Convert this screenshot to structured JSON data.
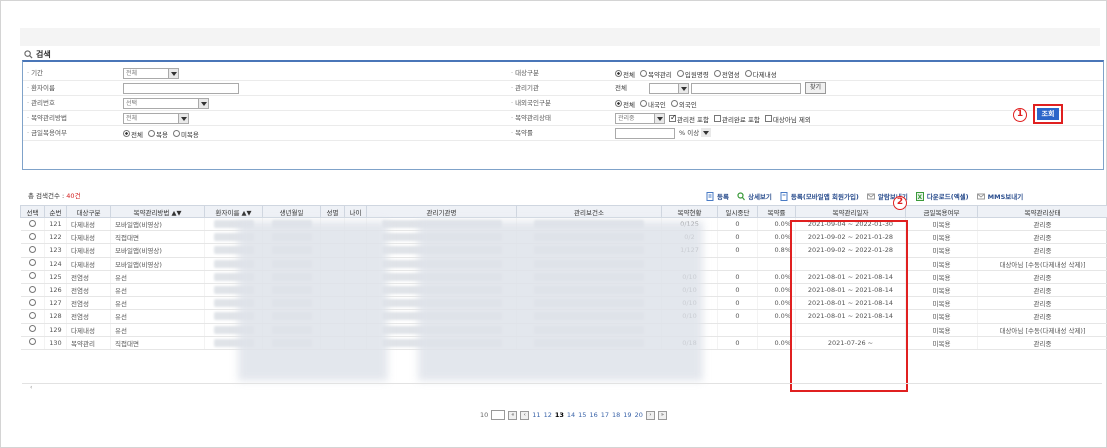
{
  "search": {
    "legend": "검색",
    "rows": {
      "period_label": "기간",
      "period_value": "전체",
      "target_label": "대상구분",
      "target_options": [
        "전체",
        "복약관리",
        "입원명령",
        "전염성",
        "다제내성"
      ],
      "patient_label": "환자이름",
      "agency_label": "관리기관",
      "agency_value": "전체",
      "find_btn": "찾기",
      "mgmt_no_label": "관리번호",
      "mgmt_no_value": "선택",
      "nationality_label": "내외국인구분",
      "nationality_options": [
        "전체",
        "내국인",
        "외국인"
      ],
      "method_label": "복약관리방법",
      "method_value": "전체",
      "status_label": "복약관리상태",
      "status_value": "관리중",
      "status_checks": [
        "관리전 포함",
        "관리완료 포함",
        "대상아님 제외"
      ],
      "takes_label": "금일복용여부",
      "takes_options": [
        "전체",
        "복용",
        "미복용"
      ],
      "rate_label": "복약률",
      "rate_suffix": "% 이상"
    },
    "query_button": "조회"
  },
  "markers": {
    "one": "1",
    "two": "2"
  },
  "result": {
    "count_prefix": "총 검색건수 : ",
    "count_value": "40건"
  },
  "toolbar": {
    "register": "등록",
    "detail": "상세보기",
    "register_app": "등록(모바일앱 회원가입)",
    "notify": "알람보내기",
    "download": "다운로드(엑셀)",
    "mms": "MMS보내기"
  },
  "table": {
    "headers": [
      "선택",
      "순번",
      "대상구분",
      "복약관리방법 ▲▼",
      "환자이름 ▲▼",
      "생년월일",
      "성별",
      "나이",
      "관리기관명",
      "관리보건소",
      "복약현황",
      "일시중단",
      "복약률",
      "복약관리일자",
      "금일복용여부",
      "복약관리상태"
    ],
    "rows": [
      {
        "no": "121",
        "type": "다제내성",
        "method": "모바일앱(비영상)",
        "status": "0/125",
        "pause": "0",
        "rate": "0.0%",
        "period": "2021-09-04 ~ 2022-01-30",
        "today": "미복용",
        "state": "관리중"
      },
      {
        "no": "122",
        "type": "다제내성",
        "method": "직접대면",
        "status": "0/2",
        "pause": "0",
        "rate": "0.0%",
        "period": "2021-09-02 ~ 2021-01-28",
        "today": "미복용",
        "state": "관리중"
      },
      {
        "no": "123",
        "type": "다제내성",
        "method": "모바일앱(비영상)",
        "status": "1/127",
        "pause": "0",
        "rate": "0.8%",
        "period": "2021-09-02 ~ 2022-01-28",
        "today": "미복용",
        "state": "관리중"
      },
      {
        "no": "124",
        "type": "다제내성",
        "method": "모바일앱(비영상)",
        "status": "",
        "pause": "",
        "rate": "",
        "period": "",
        "today": "미복용",
        "state": "대상아님 [수동(다제내성 삭제)]"
      },
      {
        "no": "125",
        "type": "전염성",
        "method": "유선",
        "status": "0/10",
        "pause": "0",
        "rate": "0.0%",
        "period": "2021-08-01 ~ 2021-08-14",
        "today": "미복용",
        "state": "관리중"
      },
      {
        "no": "126",
        "type": "전염성",
        "method": "유선",
        "status": "0/10",
        "pause": "0",
        "rate": "0.0%",
        "period": "2021-08-01 ~ 2021-08-14",
        "today": "미복용",
        "state": "관리중"
      },
      {
        "no": "127",
        "type": "전염성",
        "method": "유선",
        "status": "0/10",
        "pause": "0",
        "rate": "0.0%",
        "period": "2021-08-01 ~ 2021-08-14",
        "today": "미복용",
        "state": "관리중"
      },
      {
        "no": "128",
        "type": "전염성",
        "method": "유선",
        "status": "0/10",
        "pause": "0",
        "rate": "0.0%",
        "period": "2021-08-01 ~ 2021-08-14",
        "today": "미복용",
        "state": "관리중"
      },
      {
        "no": "129",
        "type": "다제내성",
        "method": "유선",
        "status": "",
        "pause": "",
        "rate": "",
        "period": "",
        "today": "미복용",
        "state": "대상아님 [수동(다제내성 삭제)]"
      },
      {
        "no": "130",
        "type": "복약관리",
        "method": "직접대면",
        "status": "0/18",
        "pause": "0",
        "rate": "0.0%",
        "period": "2021-07-26 ~",
        "today": "미복용",
        "state": "관리중"
      }
    ]
  },
  "pager": {
    "size": "10",
    "pages": [
      "11",
      "12",
      "13",
      "14",
      "15",
      "16",
      "17",
      "18",
      "19",
      "20"
    ],
    "current": "13"
  },
  "colors": {
    "accent": "#2c66c9",
    "highlight": "#e02020",
    "count": "#d32020"
  }
}
